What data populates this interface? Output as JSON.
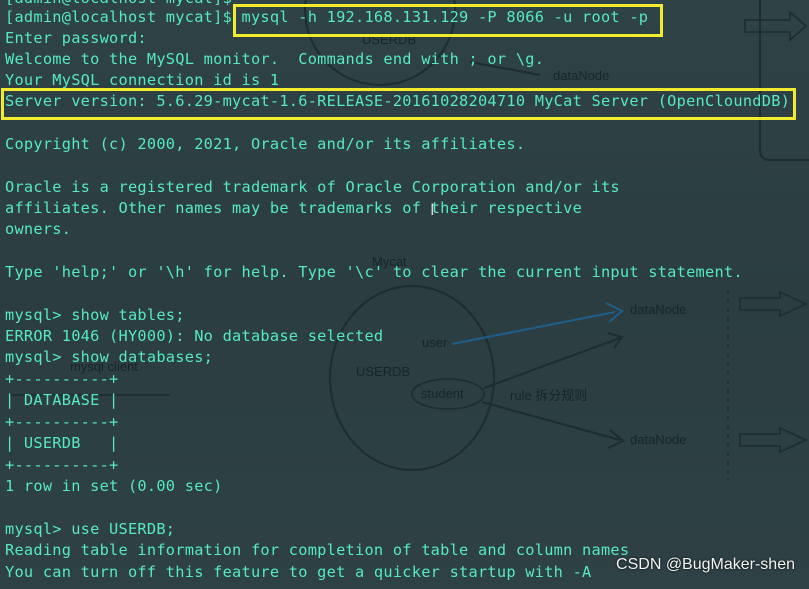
{
  "terminal": {
    "lines": [
      "[admin@localhost mycat]$",
      "[admin@localhost mycat]$ mysql -h 192.168.131.129 -P 8066 -u root -p",
      "Enter password:",
      "Welcome to the MySQL monitor.  Commands end with ; or \\g.",
      "Your MySQL connection id is 1",
      "Server version: 5.6.29-mycat-1.6-RELEASE-20161028204710 MyCat Server (OpenCloundDB)",
      "",
      "Copyright (c) 2000, 2021, Oracle and/or its affiliates.",
      "",
      "Oracle is a registered trademark of Oracle Corporation and/or its",
      "affiliates. Other names may be trademarks of their respective",
      "owners.",
      "",
      "Type 'help;' or '\\h' for help. Type '\\c' to clear the current input statement.",
      "",
      "mysql> show tables;",
      "ERROR 1046 (HY000): No database selected",
      "mysql> show databases;",
      "+----------+",
      "| DATABASE |",
      "+----------+",
      "| USERDB   |",
      "+----------+",
      "1 row in set (0.00 sec)",
      "",
      "mysql> use USERDB;",
      "Reading table information for completion of table and column names",
      "You can turn off this feature to get a quicker startup with -A"
    ],
    "text_color": "#56e9c2",
    "highlight_color": "#f2ea2c"
  },
  "background_drawing": {
    "labels": {
      "userdb_top": "USERDB",
      "datanode_top": "dataNode",
      "mycat": "Mycat",
      "user": "user",
      "userdb": "USERDB",
      "student": "student",
      "rule": "rule 拆分规则",
      "datanode_1": "dataNode",
      "datanode_2": "dataNode",
      "mysql_client": "mysql client"
    }
  },
  "watermark": "CSDN @BugMaker-shen"
}
